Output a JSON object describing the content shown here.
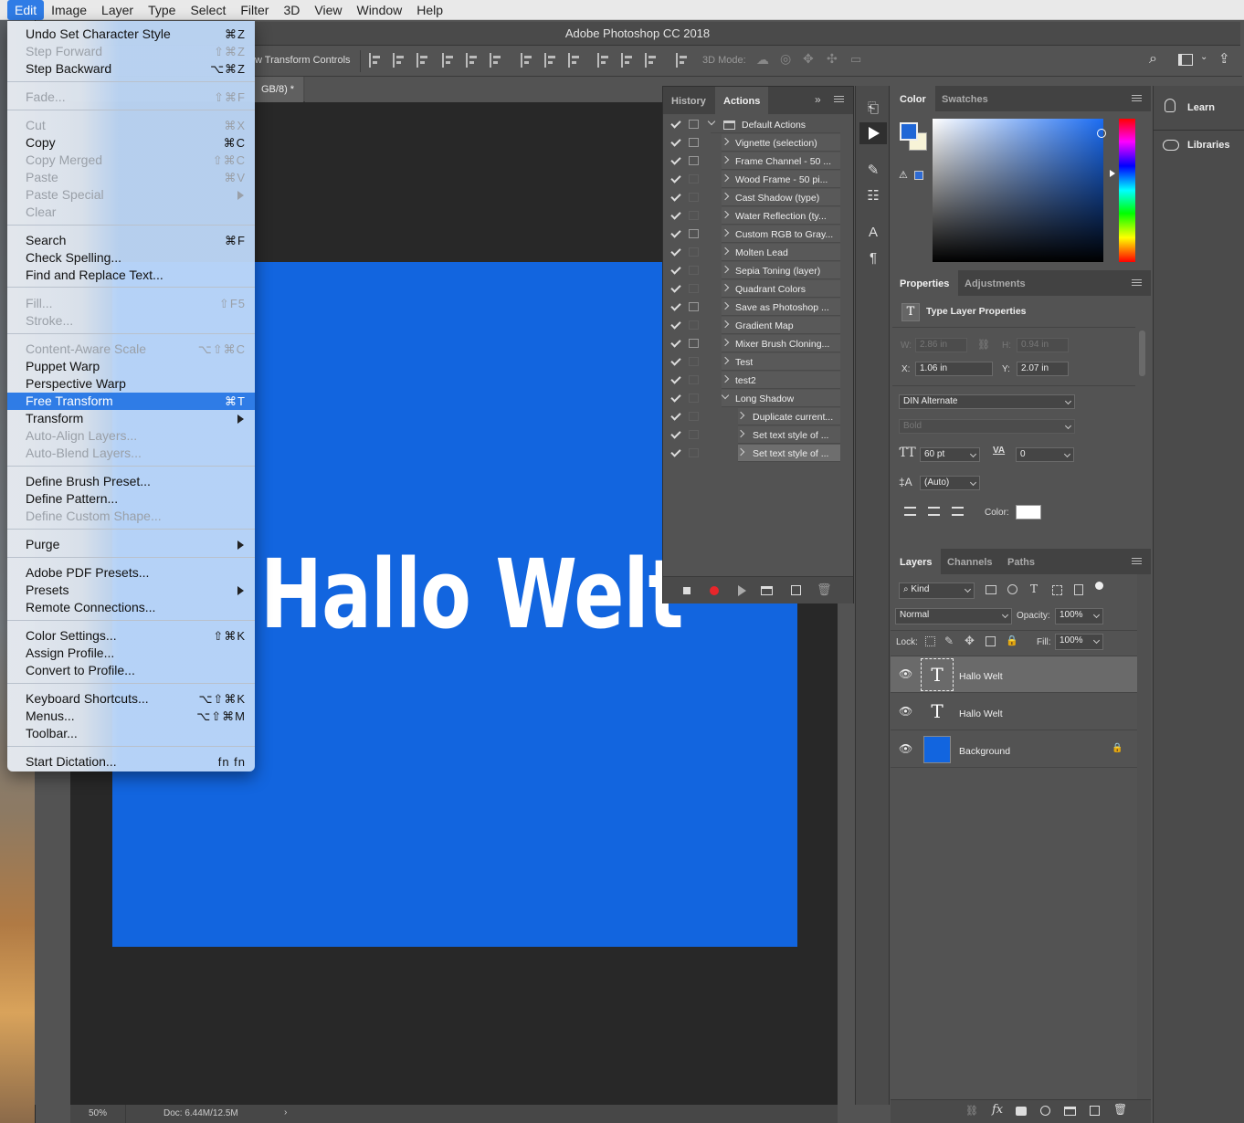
{
  "app": {
    "window_title": "Adobe Photoshop CC 2018"
  },
  "menubar": {
    "items": [
      "Edit",
      "Image",
      "Layer",
      "Type",
      "Select",
      "Filter",
      "3D",
      "View",
      "Window",
      "Help"
    ]
  },
  "edit_menu": {
    "items": [
      {
        "label": "Undo Set Character Style",
        "shortcut": "⌘Z"
      },
      {
        "label": "Step Forward",
        "shortcut": "⇧⌘Z"
      },
      {
        "label": "Step Backward",
        "shortcut": "⌥⌘Z"
      },
      {
        "label": "Fade...",
        "shortcut": "⇧⌘F"
      },
      {
        "label": "Cut",
        "shortcut": "⌘X"
      },
      {
        "label": "Copy",
        "shortcut": "⌘C"
      },
      {
        "label": "Copy Merged",
        "shortcut": "⇧⌘C"
      },
      {
        "label": "Paste",
        "shortcut": "⌘V"
      },
      {
        "label": "Paste Special",
        "shortcut": ""
      },
      {
        "label": "Clear",
        "shortcut": ""
      },
      {
        "label": "Search",
        "shortcut": "⌘F"
      },
      {
        "label": "Check Spelling...",
        "shortcut": ""
      },
      {
        "label": "Find and Replace Text...",
        "shortcut": ""
      },
      {
        "label": "Fill...",
        "shortcut": "⇧F5"
      },
      {
        "label": "Stroke...",
        "shortcut": ""
      },
      {
        "label": "Content-Aware Scale",
        "shortcut": "⌥⇧⌘C"
      },
      {
        "label": "Puppet Warp",
        "shortcut": ""
      },
      {
        "label": "Perspective Warp",
        "shortcut": ""
      },
      {
        "label": "Free Transform",
        "shortcut": "⌘T"
      },
      {
        "label": "Transform",
        "shortcut": ""
      },
      {
        "label": "Auto-Align Layers...",
        "shortcut": ""
      },
      {
        "label": "Auto-Blend Layers...",
        "shortcut": ""
      },
      {
        "label": "Define Brush Preset...",
        "shortcut": ""
      },
      {
        "label": "Define Pattern...",
        "shortcut": ""
      },
      {
        "label": "Define Custom Shape...",
        "shortcut": ""
      },
      {
        "label": "Purge",
        "shortcut": ""
      },
      {
        "label": "Adobe PDF Presets...",
        "shortcut": ""
      },
      {
        "label": "Presets",
        "shortcut": ""
      },
      {
        "label": "Remote Connections...",
        "shortcut": ""
      },
      {
        "label": "Color Settings...",
        "shortcut": "⇧⌘K"
      },
      {
        "label": "Assign Profile...",
        "shortcut": ""
      },
      {
        "label": "Convert to Profile...",
        "shortcut": ""
      },
      {
        "label": "Keyboard Shortcuts...",
        "shortcut": "⌥⇧⌘K"
      },
      {
        "label": "Menus...",
        "shortcut": "⌥⇧⌘M"
      },
      {
        "label": "Toolbar...",
        "shortcut": ""
      },
      {
        "label": "Start Dictation...",
        "shortcut": "fn fn"
      }
    ]
  },
  "options_bar": {
    "transform_controls": "w Transform Controls",
    "mode_3d": "3D Mode:"
  },
  "document": {
    "tab_label": "GB/8) *",
    "canvas_text": "Hallo Welt",
    "canvas_color": "#1265df"
  },
  "status": {
    "zoom": "50%",
    "doc_size": "Doc: 6.44M/12.5M"
  },
  "actions_panel": {
    "tabs": [
      "History",
      "Actions"
    ],
    "items": [
      "Default Actions",
      "Vignette (selection)",
      "Frame Channel - 50 ...",
      "Wood Frame - 50 pi...",
      "Cast Shadow (type)",
      "Water Reflection (ty...",
      "Custom RGB to Gray...",
      "Molten Lead",
      "Sepia Toning (layer)",
      "Quadrant Colors",
      "Save as Photoshop ...",
      "Gradient Map",
      "Mixer Brush Cloning...",
      "Test",
      "test2",
      "Long Shadow",
      "Duplicate current...",
      "Set text style of ...",
      "Set text style of ..."
    ]
  },
  "color_panel": {
    "tabs": [
      "Color",
      "Swatches"
    ],
    "foreground": "#1f66d6",
    "background": "#f7f3d7"
  },
  "properties_panel": {
    "tabs": [
      "Properties",
      "Adjustments"
    ],
    "heading": "Type Layer Properties",
    "w_label": "W:",
    "w_value": "2.86 in",
    "h_label": "H:",
    "h_value": "0.94 in",
    "x_label": "X:",
    "x_value": "1.06 in",
    "y_label": "Y:",
    "y_value": "2.07 in",
    "font_family": "DIN Alternate",
    "font_style": "Bold",
    "font_size": "60 pt",
    "tracking": "0",
    "leading": "(Auto)",
    "color_label": "Color:"
  },
  "layers_panel": {
    "tabs": [
      "Layers",
      "Channels",
      "Paths"
    ],
    "filter_kind": "Kind",
    "blend_mode": "Normal",
    "opacity_label": "Opacity:",
    "opacity_value": "100%",
    "lock_label": "Lock:",
    "fill_label": "Fill:",
    "fill_value": "100%",
    "layers": [
      "Hallo Welt",
      "Hallo Welt",
      "Background"
    ]
  },
  "side_panel": {
    "learn": "Learn",
    "libraries": "Libraries"
  }
}
